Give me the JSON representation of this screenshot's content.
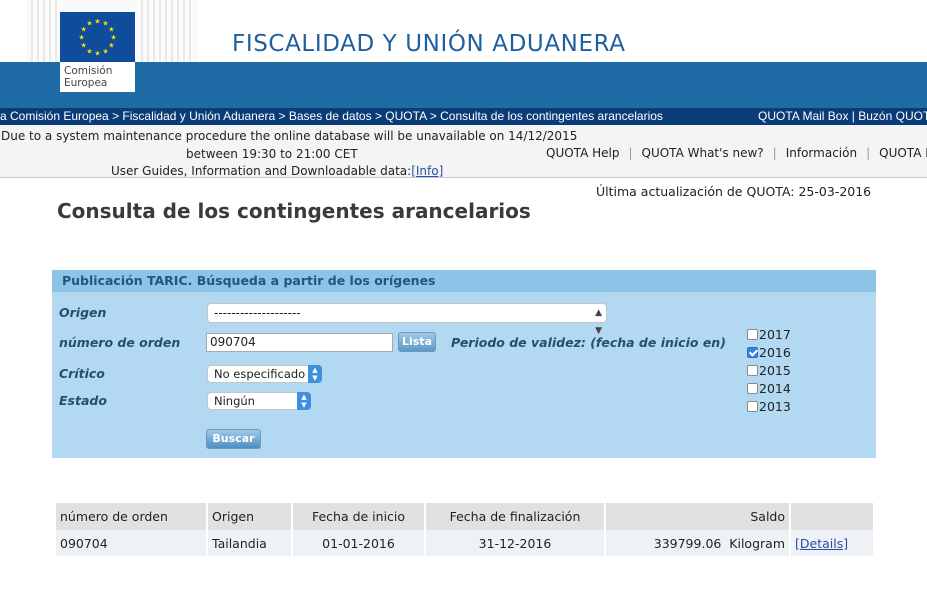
{
  "header": {
    "logo_line1": "Comisión",
    "logo_line2": "Europea",
    "site_title": "FISCALIDAD Y UNIÓN ADUANERA"
  },
  "breadcrumb": {
    "items": [
      "a Comisión Europea",
      "Fiscalidad y Unión Aduanera",
      "Bases de datos",
      "QUOTA",
      "Consulta de los contingentes arancelarios"
    ],
    "separator": " > ",
    "right_links": "QUOTA Mail Box | Buzón QUOT"
  },
  "notice": {
    "line1": "Due to a system maintenance procedure the online database will be unavailable on 14/12/2015",
    "line2": "between 19:30 to 21:00 CET",
    "line3": "User Guides, Information and Downloadable data:",
    "info_link": "[Info]"
  },
  "top_links": [
    "QUOTA Help",
    "QUOTA What's new?",
    "Información",
    "QUOTA FAQ"
  ],
  "last_update": "Última actualización de QUOTA: 25-03-2016",
  "page_title": "Consulta de los contingentes arancelarios",
  "search_panel": {
    "heading": "Publicación TARIC. Búsqueda a partir de los orígenes",
    "origen_label": "Origen",
    "origen_value": "--------------------",
    "orden_label": "número de orden",
    "orden_value": "090704",
    "lista_button": "Lista",
    "periodo_label": "Periodo de validez: (fecha de inicio en)",
    "critico_label": "Crítico",
    "critico_value": "No especificado",
    "estado_label": "Estado",
    "estado_value": "Ningún",
    "buscar_button": "Buscar",
    "years": [
      {
        "label": "2017",
        "checked": false
      },
      {
        "label": "2016",
        "checked": true
      },
      {
        "label": "2015",
        "checked": false
      },
      {
        "label": "2014",
        "checked": false
      },
      {
        "label": "2013",
        "checked": false
      }
    ]
  },
  "results": {
    "headers": [
      "número de orden",
      "Origen",
      "Fecha de inicio",
      "Fecha de finalización",
      "Saldo",
      ""
    ],
    "rows": [
      {
        "orden": "090704",
        "origen": "Tailandia",
        "inicio": "01-01-2016",
        "fin": "31-12-2016",
        "saldo": "339799.06  Kilogram",
        "details": "[Details]"
      }
    ]
  },
  "colors": {
    "header_blue": "#1f6ba6",
    "breadcrumb_bg": "#0a3d78",
    "panel_bg": "#b3d9f2",
    "panel_head_bg": "#8cc4e8",
    "link": "#2a4ea6"
  }
}
